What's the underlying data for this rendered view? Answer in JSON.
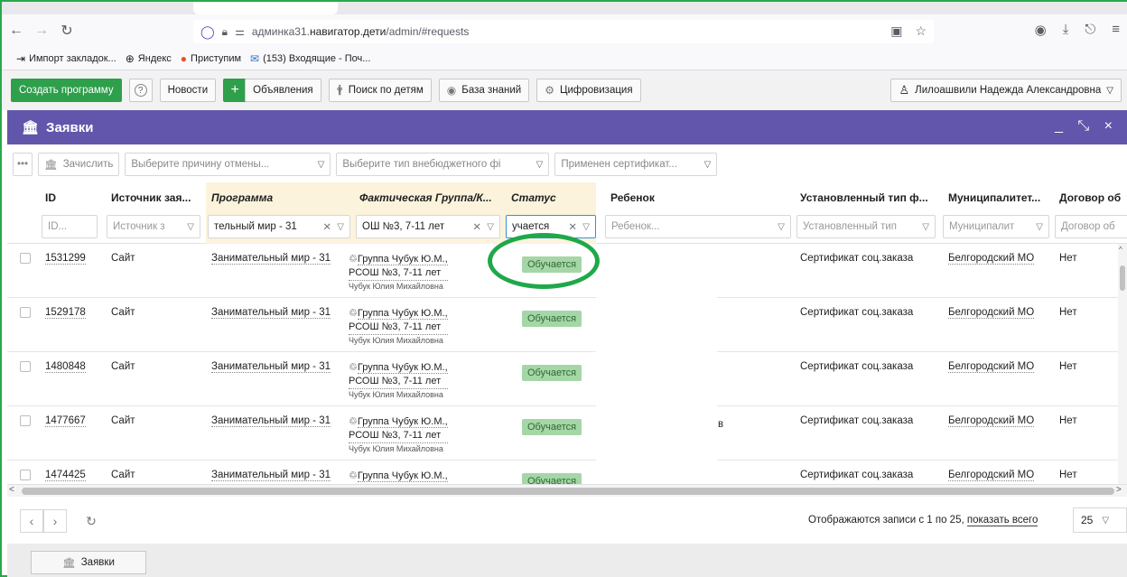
{
  "browser": {
    "url_prefix": "админка31.",
    "url_domain": "навигатор.дети",
    "url_path": "/admin/#requests",
    "bookmarks": [
      {
        "icon": "import-icon",
        "label": "Импорт закладок..."
      },
      {
        "icon": "globe-icon",
        "label": "Яндекс"
      },
      {
        "icon": "circle-icon",
        "label": "Приступим"
      },
      {
        "icon": "mail-icon",
        "label": "(153) Входящие - Поч..."
      }
    ]
  },
  "toolbar": {
    "create_program": "Создать программу",
    "help": "?",
    "news": "Новости",
    "plus": "+",
    "announcements": "Объявления",
    "search_children": "Поиск по детям",
    "knowledge_base": "База знаний",
    "digitalization": "Цифровизация",
    "user_name": "Лилоашвили Надежда Александровна"
  },
  "panel": {
    "title": "Заявки",
    "controls": "_ ⤡ ×"
  },
  "filterbar": {
    "more": "•••",
    "enroll": "Зачислить",
    "cancel_reason": "Выберите причину отмены...",
    "budget_type": "Выберите тип внебюджетного фі",
    "certificate": "Применен сертификат..."
  },
  "columns": {
    "id": "ID",
    "source": "Источник зая...",
    "program": "Программа",
    "group": "Фактическая Группа/К...",
    "status": "Статус",
    "child": "Ребенок",
    "fin_type": "Установленный тип ф...",
    "municipality": "Муниципалитет...",
    "contract": "Договор об"
  },
  "filters": {
    "id": "ID...",
    "source": "Источник з",
    "program": "тельный мир - 31",
    "group": "ОШ №3, 7-11 лет",
    "status": "учается",
    "child": "Ребенок...",
    "fin_type": "Установленный тип",
    "municipality": "Муниципалит",
    "contract": "Договор об"
  },
  "rows": [
    {
      "id": "1531299",
      "source": "Сайт",
      "program": "Занимательный мир - 31",
      "group_line1": "Группа Чубук Ю.М.,",
      "group_line2": "РСОШ №3, 7-11 лет",
      "teacher": "Чубук Юлия Михайловна",
      "status": "Обучается",
      "child": "",
      "fin_type": "Сертификат соц.заказа",
      "municipality": "Белгородский МО",
      "contract": "Нет"
    },
    {
      "id": "1529178",
      "source": "Сайт",
      "program": "Занимательный мир - 31",
      "group_line1": "Группа Чубук Ю.М.,",
      "group_line2": "РСОШ №3, 7-11 лет",
      "teacher": "Чубук Юлия Михайловна",
      "status": "Обучается",
      "child": "",
      "fin_type": "Сертификат соц.заказа",
      "municipality": "Белгородский МО",
      "contract": "Нет"
    },
    {
      "id": "1480848",
      "source": "Сайт",
      "program": "Занимательный мир - 31",
      "group_line1": "Группа Чубук Ю.М.,",
      "group_line2": "РСОШ №3, 7-11 лет",
      "teacher": "Чубук Юлия Михайловна",
      "status": "Обучается",
      "child": "",
      "fin_type": "Сертификат соц.заказа",
      "municipality": "Белгородский МО",
      "contract": "Нет"
    },
    {
      "id": "1477667",
      "source": "Сайт",
      "program": "Занимательный мир - 31",
      "group_line1": "Группа Чубук Ю.М.,",
      "group_line2": "РСОШ №3, 7-11 лет",
      "teacher": "Чубук Юлия Михайловна",
      "status": "Обучается",
      "child": "в",
      "fin_type": "Сертификат соц.заказа",
      "municipality": "Белгородский МО",
      "contract": "Нет"
    },
    {
      "id": "1474425",
      "source": "Сайт",
      "program": "Занимательный мир - 31",
      "group_line1": "Группа Чубук Ю.М.,",
      "group_line2": "",
      "teacher": "",
      "status": "Обучается",
      "child": "",
      "fin_type": "Сертификат соц.заказа",
      "municipality": "Белгородский МО",
      "contract": "Нет"
    }
  ],
  "pager": {
    "info_prefix": "Отображаются записи с 1 по 25, ",
    "show_all": "показать всего",
    "page_size": "25"
  },
  "taskbar": {
    "requests": "Заявки"
  }
}
